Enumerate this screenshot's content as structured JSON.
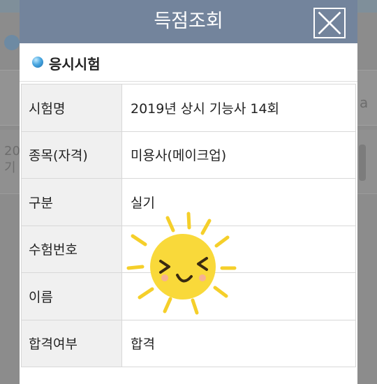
{
  "modal": {
    "title": "득점조회",
    "section_title": "응시시험"
  },
  "rows": [
    {
      "label": "시험명",
      "value": "2019년 상시 기능사 14회"
    },
    {
      "label": "종목(자격)",
      "value": "미용사(메이크업)"
    },
    {
      "label": "구분",
      "value": "실기"
    },
    {
      "label": "수험번호",
      "value": ""
    },
    {
      "label": "이름",
      "value": ""
    },
    {
      "label": "합격여부",
      "value": "합격"
    }
  ],
  "background": {
    "left_text": "20\n기",
    "right_text": "a"
  },
  "colors": {
    "header": "#73849c",
    "label_bg": "#f0f0f0",
    "sticker": "#f9d93a"
  }
}
